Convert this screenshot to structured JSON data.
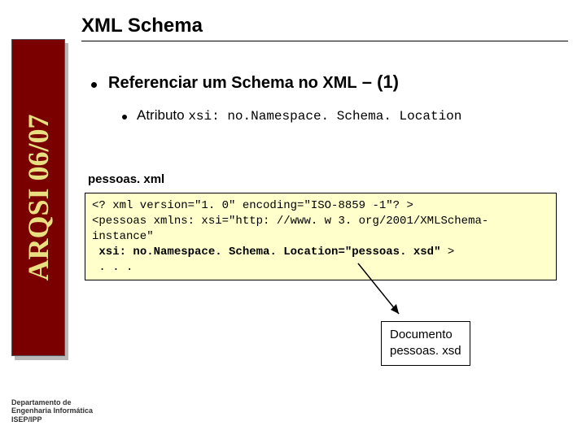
{
  "sidebar": {
    "label": "ARQSI 06/07"
  },
  "footer": {
    "line1": "Departamento de",
    "line2": "Engenharia Informática",
    "line3": "ISEP/IPP"
  },
  "title": "XML Schema",
  "bullet1": {
    "main": "Referenciar um Schema no XML",
    "tail": " – (1)"
  },
  "bullet2": {
    "prefix": "Atributo ",
    "code": "xsi: no.Namespace. Schema. Location"
  },
  "file": {
    "name": "pessoas. xml"
  },
  "code": {
    "l1": "<? xml version=\"1. 0\" encoding=\"ISO-8859 -1\"? >",
    "l2": "<pessoas xmlns: xsi=\"http: //www. w 3. org/2001/XMLSchema-instance\"",
    "l3a": " xsi: no.Namespace. Schema. Location=\"pessoas. xsd\"",
    "l3b": " >",
    "l4": " . . ."
  },
  "docbox": {
    "line1": "Documento",
    "line2": "pessoas. xsd"
  }
}
